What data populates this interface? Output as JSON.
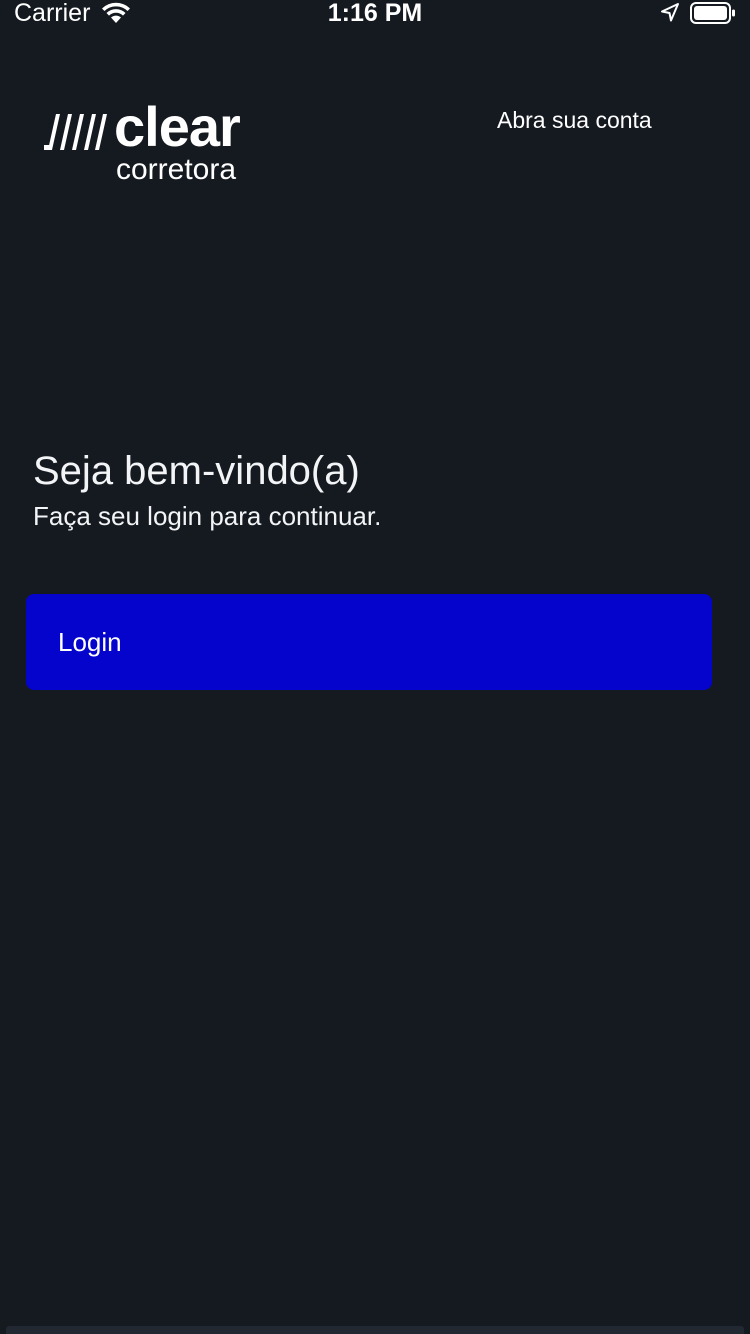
{
  "status_bar": {
    "carrier": "Carrier",
    "time": "1:16 PM",
    "icons": [
      "wifi-icon",
      "location-icon",
      "battery-icon"
    ]
  },
  "header": {
    "logo_text": "clear",
    "logo_subtext": "corretora",
    "open_account_label": "Abra sua conta"
  },
  "welcome": {
    "title": "Seja bem-vindo(a)",
    "subtitle": "Faça seu login para continuar."
  },
  "login": {
    "label": "Login"
  },
  "colors": {
    "background": "#151a21",
    "primary_button": "#0404cc",
    "text": "#ffffff"
  }
}
